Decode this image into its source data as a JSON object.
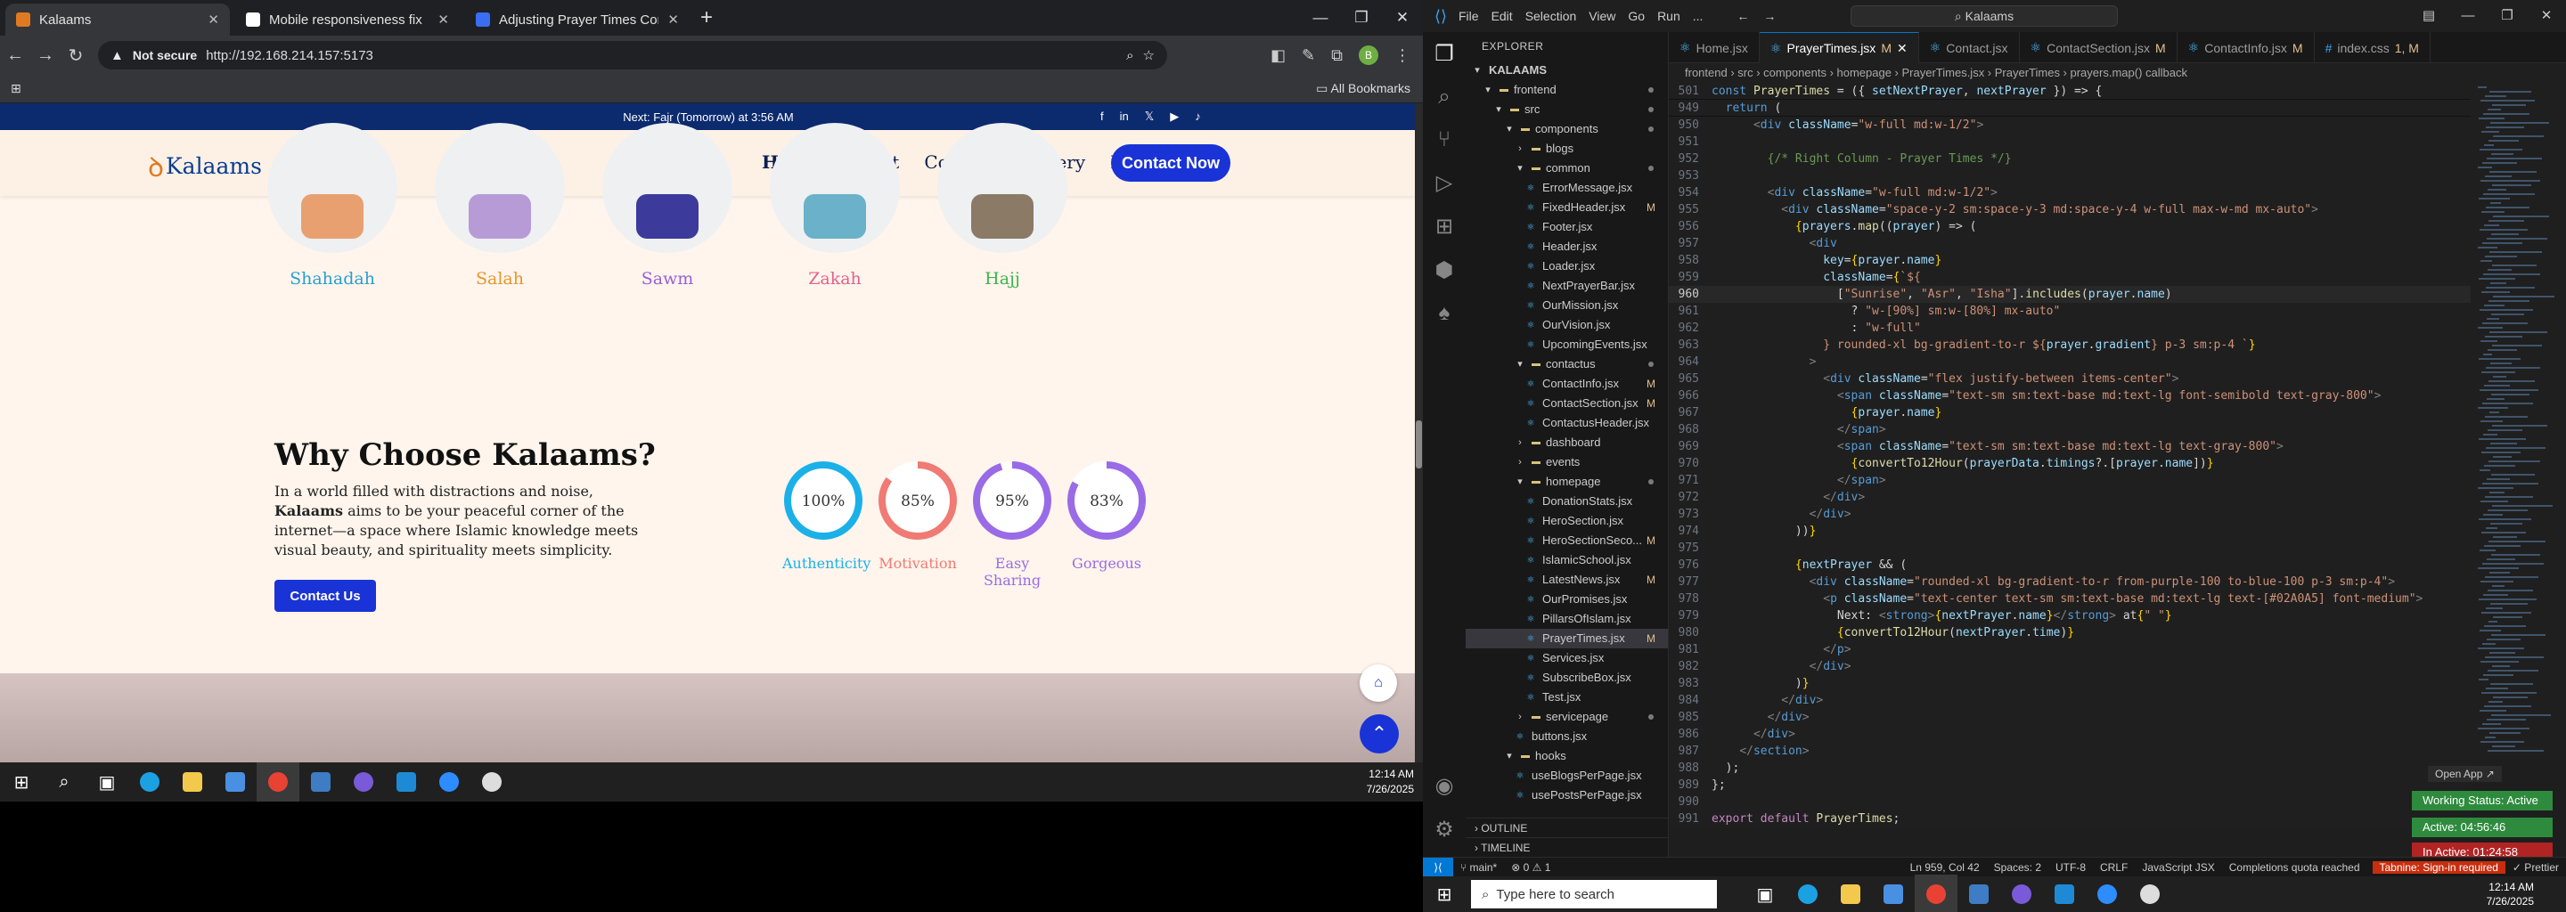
{
  "chrome": {
    "tabs": [
      {
        "title": "Kalaams",
        "favicon_color": "#e07a22",
        "active": true
      },
      {
        "title": "Mobile responsiveness fix",
        "favicon_color": "#ffffff",
        "active": false
      },
      {
        "title": "Adjusting Prayer Times Contain",
        "favicon_color": "#3b6df2",
        "active": false
      }
    ],
    "security": "Not secure",
    "url": "http://192.168.214.157:5173",
    "bookmarks_label": "All Bookmarks",
    "profile_initial": "B"
  },
  "site": {
    "topbar_text": "Next: Fajr (Tomorrow) at 3:56 AM",
    "logo_text": "Kalaams",
    "nav": [
      "Home",
      "About",
      "Contact",
      "Gallery",
      "Blogs"
    ],
    "cta": "Contact Now",
    "pillars": [
      {
        "label": "Shahadah",
        "color": "#2a9fcf",
        "ill": "#e8a070"
      },
      {
        "label": "Salah",
        "color": "#e8962a",
        "ill": "#b79bd6"
      },
      {
        "label": "Sawm",
        "color": "#9a5fd6",
        "ill": "#3c3a9b"
      },
      {
        "label": "Zakah",
        "color": "#e0628c",
        "ill": "#6ab1c9"
      },
      {
        "label": "Hajj",
        "color": "#3cb44b",
        "ill": "#8a7a66"
      }
    ],
    "why_title": "Why Choose Kalaams?",
    "why_text_before": "In a world filled with distractions and noise, ",
    "why_text_bold": "Kalaams",
    "why_text_after": " aims to be your peaceful corner of the internet—a space where Islamic knowledge meets visual beauty, and spirituality meets simplicity.",
    "why_button": "Contact Us",
    "gauges": [
      {
        "value": 100,
        "label": "Authenticity",
        "color": "#1bb0e8"
      },
      {
        "value": 85,
        "label": "Motivation",
        "color": "#f07a74"
      },
      {
        "value": 95,
        "label": "Easy Sharing",
        "color": "#9a6be6"
      },
      {
        "value": 83,
        "label": "Gorgeous",
        "color": "#9a6be6"
      }
    ]
  },
  "left_clock": {
    "time": "12:14 AM",
    "date": "7/26/2025"
  },
  "vscode": {
    "menu": [
      "File",
      "Edit",
      "Selection",
      "View",
      "Go",
      "Run",
      "..."
    ],
    "search": "Kalaams",
    "explorer_title": "EXPLORER",
    "root": "KALAAMS",
    "tree": [
      {
        "d": 1,
        "k": "fold-open",
        "n": "frontend",
        "m": "dot"
      },
      {
        "d": 2,
        "k": "fold-open",
        "n": "src",
        "m": "dot"
      },
      {
        "d": 3,
        "k": "fold-open",
        "n": "components",
        "m": "dot"
      },
      {
        "d": 4,
        "k": "fold",
        "n": "blogs",
        "m": ""
      },
      {
        "d": 4,
        "k": "fold-open",
        "n": "common",
        "m": "dot"
      },
      {
        "d": 5,
        "k": "file",
        "n": "ErrorMessage.jsx",
        "m": ""
      },
      {
        "d": 5,
        "k": "file",
        "n": "FixedHeader.jsx",
        "m": "M"
      },
      {
        "d": 5,
        "k": "file",
        "n": "Footer.jsx",
        "m": ""
      },
      {
        "d": 5,
        "k": "file",
        "n": "Header.jsx",
        "m": ""
      },
      {
        "d": 5,
        "k": "file",
        "n": "Loader.jsx",
        "m": ""
      },
      {
        "d": 5,
        "k": "file",
        "n": "NextPrayerBar.jsx",
        "m": ""
      },
      {
        "d": 5,
        "k": "file",
        "n": "OurMission.jsx",
        "m": ""
      },
      {
        "d": 5,
        "k": "file",
        "n": "OurVision.jsx",
        "m": ""
      },
      {
        "d": 5,
        "k": "file",
        "n": "UpcomingEvents.jsx",
        "m": ""
      },
      {
        "d": 4,
        "k": "fold-open",
        "n": "contactus",
        "m": "dot"
      },
      {
        "d": 5,
        "k": "file",
        "n": "ContactInfo.jsx",
        "m": "M"
      },
      {
        "d": 5,
        "k": "file",
        "n": "ContactSection.jsx",
        "m": "M"
      },
      {
        "d": 5,
        "k": "file",
        "n": "ContactusHeader.jsx",
        "m": ""
      },
      {
        "d": 4,
        "k": "fold",
        "n": "dashboard",
        "m": ""
      },
      {
        "d": 4,
        "k": "fold",
        "n": "events",
        "m": ""
      },
      {
        "d": 4,
        "k": "fold-open",
        "n": "homepage",
        "m": "dot"
      },
      {
        "d": 5,
        "k": "file",
        "n": "DonationStats.jsx",
        "m": ""
      },
      {
        "d": 5,
        "k": "file",
        "n": "HeroSection.jsx",
        "m": ""
      },
      {
        "d": 5,
        "k": "file",
        "n": "HeroSectionSeco...",
        "m": "M"
      },
      {
        "d": 5,
        "k": "file",
        "n": "IslamicSchool.jsx",
        "m": ""
      },
      {
        "d": 5,
        "k": "file",
        "n": "LatestNews.jsx",
        "m": "M"
      },
      {
        "d": 5,
        "k": "file",
        "n": "OurPromises.jsx",
        "m": ""
      },
      {
        "d": 5,
        "k": "file",
        "n": "PillarsOfIslam.jsx",
        "m": ""
      },
      {
        "d": 5,
        "k": "file",
        "n": "PrayerTimes.jsx",
        "m": "M",
        "sel": true
      },
      {
        "d": 5,
        "k": "file",
        "n": "Services.jsx",
        "m": ""
      },
      {
        "d": 5,
        "k": "file",
        "n": "SubscribeBox.jsx",
        "m": ""
      },
      {
        "d": 5,
        "k": "file",
        "n": "Test.jsx",
        "m": ""
      },
      {
        "d": 4,
        "k": "fold",
        "n": "servicepage",
        "m": "dot"
      },
      {
        "d": 4,
        "k": "file",
        "n": "buttons.jsx",
        "m": ""
      },
      {
        "d": 3,
        "k": "fold-open",
        "n": "hooks",
        "m": ""
      },
      {
        "d": 4,
        "k": "file",
        "n": "useBlogsPerPage.jsx",
        "m": ""
      },
      {
        "d": 4,
        "k": "file",
        "n": "usePostsPerPage.jsx",
        "m": ""
      }
    ],
    "outline": "OUTLINE",
    "timeline": "TIMELINE",
    "tabs": [
      {
        "n": "Home.jsx",
        "m": ""
      },
      {
        "n": "PrayerTimes.jsx",
        "m": "M",
        "act": true
      },
      {
        "n": "Contact.jsx",
        "m": ""
      },
      {
        "n": "ContactSection.jsx",
        "m": "M"
      },
      {
        "n": "ContactInfo.jsx",
        "m": "M"
      },
      {
        "n": "index.css",
        "m": "1, M"
      }
    ],
    "breadcrumb": "frontend › src › components › homepage › PrayerTimes.jsx › PrayerTimes › prayers.map() callback",
    "sticky": [
      {
        "n": "501",
        "h": "<span class=\"k\">const</span> <span class=\"f\">PrayerTimes</span> = ({ <span class=\"v\">setNextPrayer</span>, <span class=\"v\">nextPrayer</span> }) => {"
      },
      {
        "n": "949",
        "h": "  <span class=\"k\">return</span> ("
      }
    ],
    "code": [
      {
        "n": "950",
        "h": "      <span class=\"p\">&lt;</span><span class=\"k\">div</span> <span class=\"v\">className</span>=<span class=\"s\">\"w-full md:w-1/2\"</span><span class=\"p\">&gt;</span>"
      },
      {
        "n": "951",
        "h": ""
      },
      {
        "n": "952",
        "h": "        <span class=\"c\">{/* Right Column - Prayer Times */}</span>"
      },
      {
        "n": "953",
        "h": ""
      },
      {
        "n": "954",
        "h": "        <span class=\"p\">&lt;</span><span class=\"k\">div</span> <span class=\"v\">className</span>=<span class=\"s\">\"w-full md:w-1/2\"</span><span class=\"p\">&gt;</span>"
      },
      {
        "n": "955",
        "h": "          <span class=\"p\">&lt;</span><span class=\"k\">div</span> <span class=\"v\">className</span>=<span class=\"s\">\"space-y-2 sm:space-y-3 md:space-y-4 w-full max-w-md mx-auto\"</span><span class=\"p\">&gt;</span>"
      },
      {
        "n": "956",
        "h": "            <span class=\"y\">{</span><span class=\"v\">prayers</span>.<span class=\"f\">map</span>((<span class=\"v\">prayer</span>) => ("
      },
      {
        "n": "957",
        "h": "              <span class=\"p\">&lt;</span><span class=\"k\">div</span>"
      },
      {
        "n": "958",
        "h": "                <span class=\"v\">key</span>=<span class=\"y\">{</span><span class=\"v\">prayer</span>.<span class=\"v\">name</span><span class=\"y\">}</span>"
      },
      {
        "n": "959",
        "h": "                <span class=\"v\">className</span>=<span class=\"y\">{</span><span class=\"s\">`${</span>"
      },
      {
        "n": "960",
        "h": "                  [<span class=\"s\">\"Sunrise\"</span>, <span class=\"s\">\"Asr\"</span>, <span class=\"s\">\"Isha\"</span>].<span class=\"f\">includes</span>(<span class=\"v\">prayer</span>.<span class=\"v\">name</span>)",
        "cur": true
      },
      {
        "n": "961",
        "h": "                    ? <span class=\"s\">\"w-[90%] sm:w-[80%] mx-auto\"</span>"
      },
      {
        "n": "962",
        "h": "                    : <span class=\"s\">\"w-full\"</span>"
      },
      {
        "n": "963",
        "h": "                <span class=\"s\">} rounded-xl bg-gradient-to-r ${</span><span class=\"v\">prayer</span>.<span class=\"v\">gradient</span><span class=\"s\">} p-3 sm:p-4 `</span><span class=\"y\">}</span>"
      },
      {
        "n": "964",
        "h": "              <span class=\"p\">&gt;</span>"
      },
      {
        "n": "965",
        "h": "                <span class=\"p\">&lt;</span><span class=\"k\">div</span> <span class=\"v\">className</span>=<span class=\"s\">\"flex justify-between items-center\"</span><span class=\"p\">&gt;</span>"
      },
      {
        "n": "966",
        "h": "                  <span class=\"p\">&lt;</span><span class=\"k\">span</span> <span class=\"v\">className</span>=<span class=\"s\">\"text-sm sm:text-base md:text-lg font-semibold text-gray-800\"</span><span class=\"p\">&gt;</span>"
      },
      {
        "n": "967",
        "h": "                    <span class=\"y\">{</span><span class=\"v\">prayer</span>.<span class=\"v\">name</span><span class=\"y\">}</span>"
      },
      {
        "n": "968",
        "h": "                  <span class=\"p\">&lt;/</span><span class=\"k\">span</span><span class=\"p\">&gt;</span>"
      },
      {
        "n": "969",
        "h": "                  <span class=\"p\">&lt;</span><span class=\"k\">span</span> <span class=\"v\">className</span>=<span class=\"s\">\"text-sm sm:text-base md:text-lg text-gray-800\"</span><span class=\"p\">&gt;</span>"
      },
      {
        "n": "970",
        "h": "                    <span class=\"y\">{</span><span class=\"f\">convertTo12Hour</span>(<span class=\"v\">prayerData</span>.<span class=\"v\">timings</span>?.[<span class=\"v\">prayer</span>.<span class=\"v\">name</span>])<span class=\"y\">}</span>"
      },
      {
        "n": "971",
        "h": "                  <span class=\"p\">&lt;/</span><span class=\"k\">span</span><span class=\"p\">&gt;</span>"
      },
      {
        "n": "972",
        "h": "                <span class=\"p\">&lt;/</span><span class=\"k\">div</span><span class=\"p\">&gt;</span>"
      },
      {
        "n": "973",
        "h": "              <span class=\"p\">&lt;/</span><span class=\"k\">div</span><span class=\"p\">&gt;</span>"
      },
      {
        "n": "974",
        "h": "            ))<span class=\"y\">}</span>"
      },
      {
        "n": "975",
        "h": ""
      },
      {
        "n": "976",
        "h": "            <span class=\"y\">{</span><span class=\"v\">nextPrayer</span> &amp;&amp; ("
      },
      {
        "n": "977",
        "h": "              <span class=\"p\">&lt;</span><span class=\"k\">div</span> <span class=\"v\">className</span>=<span class=\"s\">\"rounded-xl bg-gradient-to-r from-purple-100 to-blue-100 p-3 sm:p-4\"</span><span class=\"p\">&gt;</span>"
      },
      {
        "n": "978",
        "h": "                <span class=\"p\">&lt;</span><span class=\"k\">p</span> <span class=\"v\">className</span>=<span class=\"s\">\"text-center text-sm sm:text-base md:text-lg text-[#02A0A5] font-medium\"</span><span class=\"p\">&gt;</span>"
      },
      {
        "n": "979",
        "h": "                  Next: <span class=\"p\">&lt;</span><span class=\"k\">strong</span><span class=\"p\">&gt;</span><span class=\"y\">{</span><span class=\"v\">nextPrayer</span>.<span class=\"v\">name</span><span class=\"y\">}</span><span class=\"p\">&lt;/</span><span class=\"k\">strong</span><span class=\"p\">&gt;</span> at<span class=\"y\">{</span><span class=\"s\">\" \"</span><span class=\"y\">}</span>"
      },
      {
        "n": "980",
        "h": "                  <span class=\"y\">{</span><span class=\"f\">convertTo12Hour</span>(<span class=\"v\">nextPrayer</span>.<span class=\"v\">time</span>)<span class=\"y\">}</span>"
      },
      {
        "n": "981",
        "h": "                <span class=\"p\">&lt;/</span><span class=\"k\">p</span><span class=\"p\">&gt;</span>"
      },
      {
        "n": "982",
        "h": "              <span class=\"p\">&lt;/</span><span class=\"k\">div</span><span class=\"p\">&gt;</span>"
      },
      {
        "n": "983",
        "h": "            )<span class=\"y\">}</span>"
      },
      {
        "n": "984",
        "h": "          <span class=\"p\">&lt;/</span><span class=\"k\">div</span><span class=\"p\">&gt;</span>"
      },
      {
        "n": "985",
        "h": "        <span class=\"p\">&lt;/</span><span class=\"k\">div</span><span class=\"p\">&gt;</span>"
      },
      {
        "n": "986",
        "h": "      <span class=\"p\">&lt;/</span><span class=\"k\">div</span><span class=\"p\">&gt;</span>"
      },
      {
        "n": "987",
        "h": "    <span class=\"p\">&lt;/</span><span class=\"k\">section</span><span class=\"p\">&gt;</span>"
      },
      {
        "n": "988",
        "h": "  );"
      },
      {
        "n": "989",
        "h": "};"
      },
      {
        "n": "990",
        "h": ""
      },
      {
        "n": "991",
        "h": "<span class=\"pk\">export</span> <span class=\"pk\">default</span> <span class=\"f\">PrayerTimes</span>;"
      }
    ],
    "badges": [
      {
        "t": "Working Status: Active",
        "c": "#2e8b3e"
      },
      {
        "t": "Active: 04:56:46",
        "c": "#2e8b3e"
      },
      {
        "t": "In Active: 01:24:58",
        "c": "#b22424"
      }
    ],
    "open_app": "Open App ↗",
    "status": {
      "branch": "main*",
      "problems": "⊗ 0 ⚠ 1",
      "position": "Ln 959, Col 42",
      "spaces": "Spaces: 2",
      "encoding": "UTF-8",
      "eol": "CRLF",
      "lang": "JavaScript JSX",
      "quota": "Completions quota reached",
      "tabnine": "Tabnine: Sign-in required",
      "prettier": "✓ Prettier"
    },
    "taskbar_search": "Type here to search",
    "clock": {
      "time": "12:14 AM",
      "date": "7/26/2025"
    }
  }
}
